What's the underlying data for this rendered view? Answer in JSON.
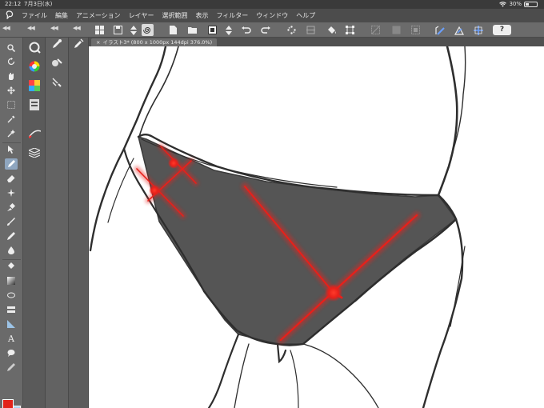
{
  "status_bar": {
    "time": "22:12",
    "date": "7月3日(水)",
    "battery": "30%",
    "battery_fraction": 0.3
  },
  "menu": {
    "logo_icon": "clip-studio-logo",
    "items": [
      "ファイル",
      "編集",
      "アニメーション",
      "レイヤー",
      "選択範囲",
      "表示",
      "フィルター",
      "ウィンドウ",
      "ヘルプ"
    ]
  },
  "toolbar": {
    "help_label": "?"
  },
  "canvas": {
    "tab_title": "イラスト3* (800 x 1000px 144dpi 376.0%)"
  },
  "colors": {
    "main_color": "#e2231a",
    "sub_color": "#a9d8f5",
    "fill_dark": "#555555",
    "red_strokes": "#e8201a",
    "canvas_bg": "#ffffff"
  }
}
